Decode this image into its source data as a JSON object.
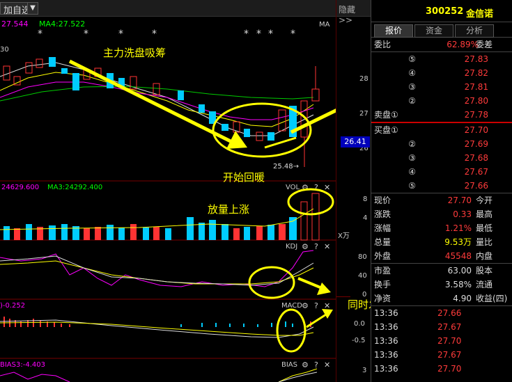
{
  "toolbar": {
    "add_label": "加自选",
    "hide_label": "隐藏 >>"
  },
  "ma_header": {
    "ma_left": "27.544",
    "ma4": "MA4:27.522",
    "ma_tag": "MA",
    "left_tick": "30"
  },
  "price_axis": [
    "28",
    "27",
    "26"
  ],
  "current_price_box": "26.41",
  "low_marker": "25.48→",
  "vol_header": {
    "left": "24629.600",
    "ma3": "MA3:24292.400",
    "tag": "VOL"
  },
  "vol_axis": [
    "8",
    "4"
  ],
  "vol_unit": "X万",
  "kdj": {
    "tag": "KDJ",
    "axis": [
      "80",
      "40",
      "0"
    ]
  },
  "macd": {
    "left": ")-0.252",
    "tag": "MACD",
    "axis": [
      "0.0",
      "-0.5"
    ]
  },
  "bias": {
    "left": "BIAS3:-4.403",
    "tag": "BIAS",
    "axis": [
      "3"
    ]
  },
  "annotations": {
    "a1": "主力洗盘吸筹",
    "a2": "开始回暖",
    "a3": "放量上涨",
    "a4": "同时发出强势金叉"
  },
  "stock": {
    "code": "300252",
    "name": "金信诺"
  },
  "tabs": [
    "报价",
    "资金",
    "分析"
  ],
  "weibi": {
    "label": "委比",
    "value": "62.89%",
    "label2": "委差"
  },
  "asks": [
    {
      "no": "⑤",
      "price": "27.83"
    },
    {
      "no": "④",
      "price": "27.82"
    },
    {
      "no": "③",
      "price": "27.81"
    },
    {
      "no": "②",
      "price": "27.80"
    },
    {
      "no": "卖盘①",
      "price": "27.78"
    }
  ],
  "bids": [
    {
      "no": "买盘①",
      "price": "27.70"
    },
    {
      "no": "②",
      "price": "27.69"
    },
    {
      "no": "③",
      "price": "27.68"
    },
    {
      "no": "④",
      "price": "27.67"
    },
    {
      "no": "⑤",
      "price": "27.66"
    }
  ],
  "quote": [
    {
      "l": "现价",
      "v": "27.70",
      "l2": "今开",
      "c": "red"
    },
    {
      "l": "涨跌",
      "v": "0.33",
      "l2": "最高",
      "c": "red"
    },
    {
      "l": "涨幅",
      "v": "1.21%",
      "l2": "最低",
      "c": "red"
    },
    {
      "l": "总量",
      "v": "9.53万",
      "l2": "量比",
      "c": "yel"
    },
    {
      "l": "外盘",
      "v": "45548",
      "l2": "内盘",
      "c": "red"
    },
    {
      "l": "市盈",
      "v": "63.00",
      "l2": "股本",
      "c": "wht"
    },
    {
      "l": "换手",
      "v": "3.58%",
      "l2": "流通",
      "c": "wht"
    },
    {
      "l": "净资",
      "v": "4.90",
      "l2": "收益(四)",
      "c": "wht"
    }
  ],
  "ticks": [
    {
      "t": "13:36",
      "p": "27.66"
    },
    {
      "t": "13:36",
      "p": "27.67"
    },
    {
      "t": "13:36",
      "p": "27.70"
    },
    {
      "t": "13:36",
      "p": "27.67"
    },
    {
      "t": "13:36",
      "p": "27.70"
    }
  ]
}
